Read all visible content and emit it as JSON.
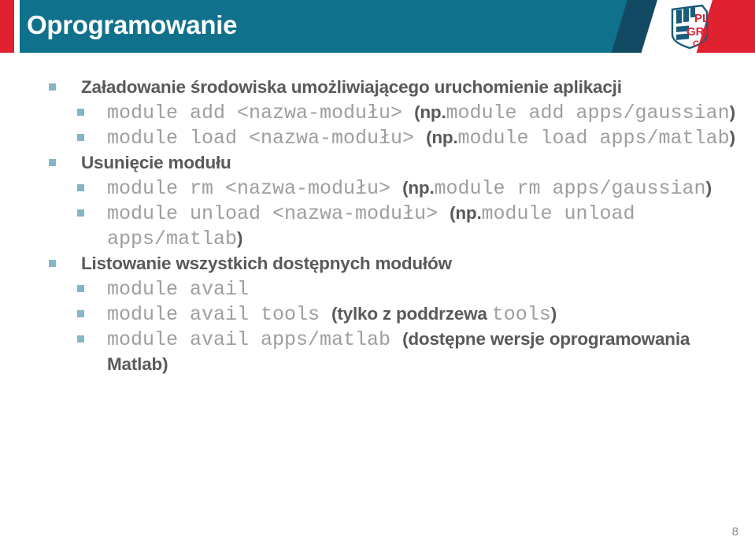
{
  "header": {
    "title": "Oprogramowanie",
    "logo_text_top": "PL",
    "logo_text_mid": "GRID",
    "logo_text_bottom": "CORE",
    "colors": {
      "teal": "#10718c",
      "navy": "#134a63",
      "red": "#e0212f",
      "title_text": "#ffffff"
    }
  },
  "content": {
    "bullet_color": "#84b5c8",
    "heading_color": "#595959",
    "command_color": "#9e9e9e",
    "sections": [
      {
        "heading": "Załadowanie środowiska umożliwiającego uruchomienie aplikacji",
        "items": [
          {
            "cmd_a": "module add <nazwa-modułu> ",
            "paren_open": "(",
            "emph": "np.",
            "cmd_b": "module add apps/gaussian",
            "paren_close": ")"
          },
          {
            "cmd_a": "module load <nazwa-modułu> ",
            "paren_open": "(",
            "emph": "np.",
            "cmd_b": "module load apps/matlab",
            "paren_close": ")"
          }
        ]
      },
      {
        "heading": "Usunięcie modułu",
        "items": [
          {
            "cmd_a": "module rm <nazwa-modułu> ",
            "paren_open": "(",
            "emph": "np.",
            "cmd_b": "module rm apps/gaussian",
            "paren_close": ")"
          },
          {
            "cmd_a": "module unload <nazwa-modułu> ",
            "paren_open": "(",
            "emph": "np.",
            "cmd_b": "module unload apps/matlab",
            "paren_close": ")"
          }
        ]
      },
      {
        "heading": "Listowanie wszystkich dostępnych modułów",
        "items": [
          {
            "cmd_a": "module avail",
            "paren_open": "",
            "emph": "",
            "cmd_b": "",
            "paren_close": ""
          },
          {
            "cmd_a": "module avail tools ",
            "paren_open": "(",
            "emph": "tylko z poddrzewa ",
            "cmd_b": "tools",
            "paren_close": ")"
          },
          {
            "cmd_a": "module avail apps/matlab ",
            "paren_open": "(",
            "emph": "dostępne wersje oprogramowania Matlab",
            "cmd_b": "",
            "paren_close": ")"
          }
        ]
      }
    ]
  },
  "footer": {
    "page_number": "8"
  }
}
